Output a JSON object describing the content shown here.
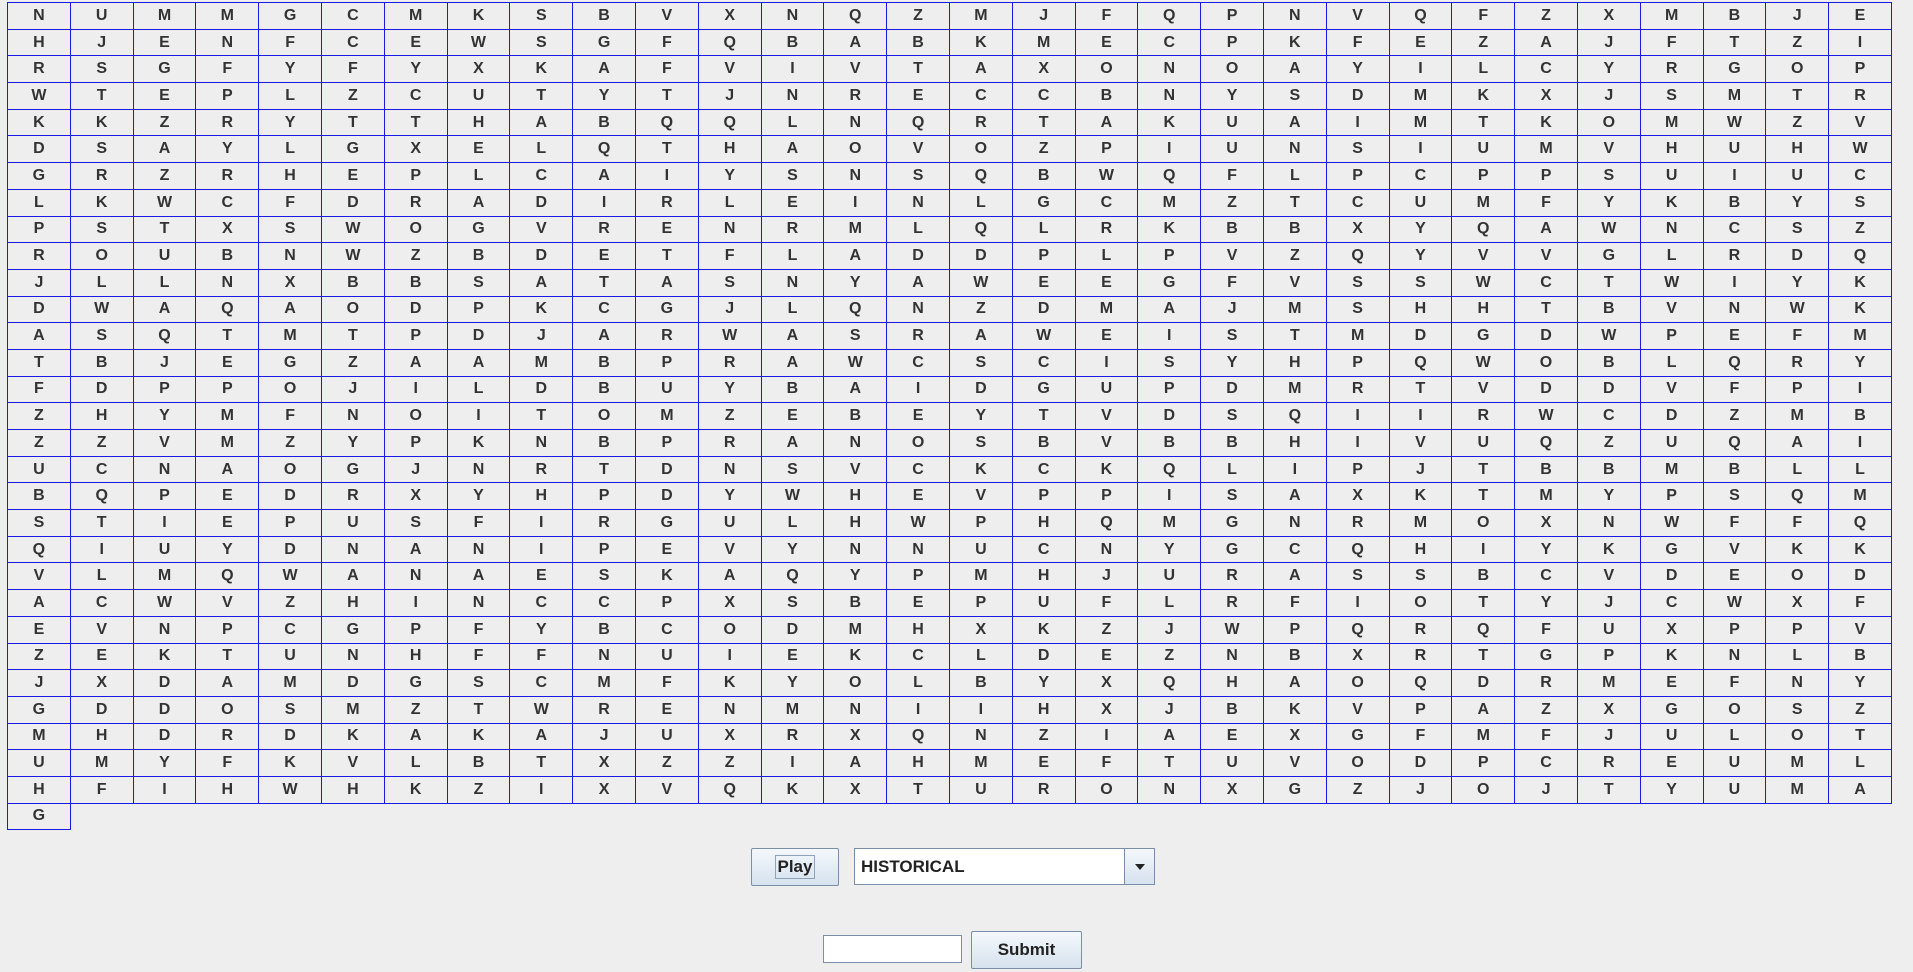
{
  "grid": {
    "rows": [
      "NUMMGCMKSBVXNQZMJFQPNVQFZXMBJE",
      "HJENFCEWSGFQBABKMECPKFEZAJFTZI",
      "RSGFYFYXKAFVIVTAXONOAYILCYRGOP",
      "WTEPLZCUTYTJNRECCBNYSDMKXJSMTR",
      "KKZRYTTHABQQLNQRTAKUAIMTKOMWZV",
      "DSAYLGXELQTHAOVOZPIUNSIUMVHUHW",
      "GRZRHEPLCAIYSNSQBWQFLPCPPSUIUC",
      "LKWCFDRADIRLEINLGCMZTCUMFYKBYS",
      "PSTXSWOGVRENRMLQLRKBBXYQAWNCSZ",
      "ROUBNWZBDETFLADDPLPVZQYVVGLRDQ",
      "JLLNXBBSATASNYAWEEGFVSSWCTWIYK",
      "DWAQAODPKCGJLQNZDMAJMSHHTBVNWK",
      "ASQTMTPDJARWASRAWEISTMDGDWPEFM",
      "TBJEGZAAMBPRAWCSCISYHPQWOBLQRY",
      "FDPPOJILDBUYBAIDGUPDMRTVDDVFPI",
      "ZHYMFNOITOMZEBEYTVDSQIIRWCDZMB",
      "ZZVMZYPKNBPRANOSBVBBHIVUQZUQAI",
      "UCNAOGJNRTDNSVCKCKQLIPJTBBMBLL",
      "BQPEDRXYHPDYWHEVPPISAXKTMYPSQM",
      "STIEPUSFIRGULHWPHQMGNRMOXNWFFQ",
      "QIUYDNANIPEVYNNUCNYGCQHIYKGVKK",
      "VLMQWANAESKAQYPMHJURASSBCVDEOD",
      "ACWVZHINCCPXSBEPUFLRFIOTYJCWXF",
      "EVNPCGPFYBCODMHXKZJWPQRQFUXPPV",
      "ZEKTUNHFFNUIEKCLDEZNBXRTGPKNLB",
      "JXDAMDGSCMFKYOLBYXQHAOQDRMEFNY",
      "GDDOSMZTWRENMNIIHXJBKVPAZXGOSZ",
      "MHDRDKAKAJUXRXQNZIAEXGFMFJULOT",
      "UMYFKVLBTXZZIAHMEFTUVODPCREUML",
      "HFIHWHKZIXVQKXTURONXGZJOJTYUMAG"
    ]
  },
  "controls": {
    "play_label": "Play",
    "category_value": "HISTORICAL",
    "answer_value": "",
    "submit_label": "Submit"
  },
  "colors": {
    "grid_line": "#1a1ae6",
    "background": "#eeeeee"
  }
}
